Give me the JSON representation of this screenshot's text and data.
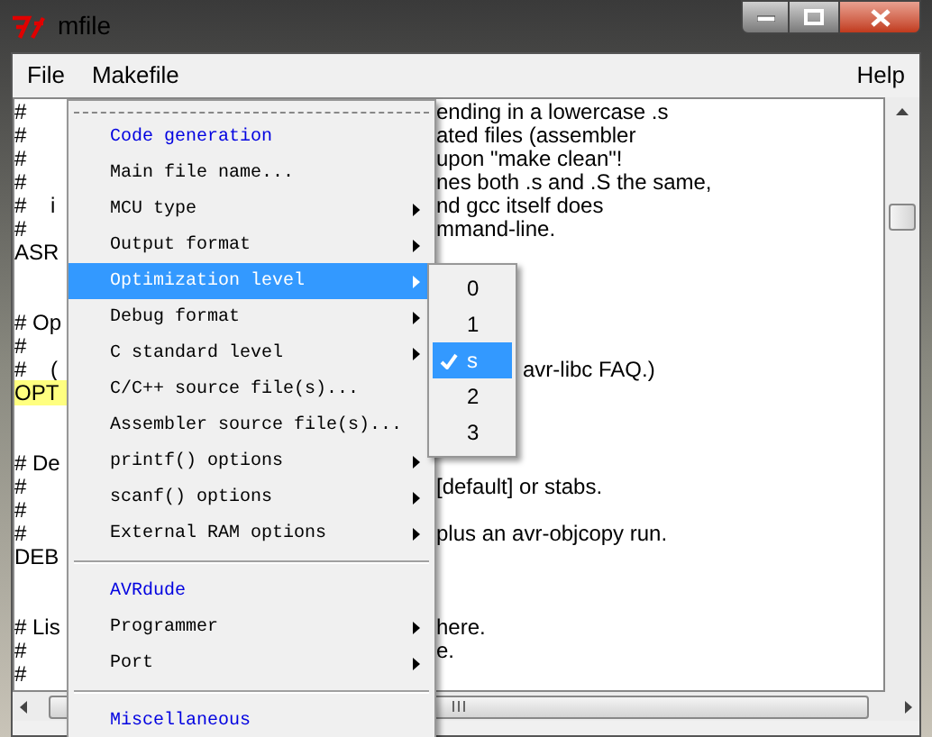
{
  "window": {
    "title": "mfile"
  },
  "menubar": [
    {
      "label": "File"
    },
    {
      "label": "Makefile"
    },
    {
      "label": "Help"
    }
  ],
  "editor_blocks": [
    {
      "lines": [
        {
          "left": "#",
          "right": "ending in a lowercase .s"
        },
        {
          "left": "#",
          "right": "ated files (assembler"
        },
        {
          "left": "#",
          "right": "upon \"make clean\"!"
        },
        {
          "left": "#",
          "right": "nes both .s and .S the same,"
        },
        {
          "left": "#    i",
          "right": "nd gcc itself does"
        },
        {
          "left": "#",
          "right": "mmand-line."
        },
        {
          "left": "ASR"
        }
      ]
    },
    {
      "lines": [
        {
          "left": "# Op"
        },
        {
          "left": "#"
        },
        {
          "left": "#    (",
          "right": "avr-libc FAQ.)"
        },
        {
          "left": "OPT",
          "highlighted": true
        }
      ]
    },
    {
      "lines": [
        {
          "left": "# De"
        },
        {
          "left": "#",
          "right": "[default] or stabs."
        },
        {
          "left": "#"
        },
        {
          "left": "#",
          "right": "plus an avr-objcopy run."
        },
        {
          "left": "DEB"
        }
      ]
    },
    {
      "lines": [
        {
          "left": "# Lis",
          "right": "here."
        },
        {
          "left": "#",
          "right": "e."
        },
        {
          "left": "#"
        }
      ]
    }
  ],
  "menu": {
    "items": [
      {
        "kind": "header",
        "label": "Code generation"
      },
      {
        "kind": "item",
        "label": "Main file name...",
        "submenu": false,
        "selected": false
      },
      {
        "kind": "item",
        "label": "MCU type",
        "submenu": true,
        "selected": false
      },
      {
        "kind": "item",
        "label": "Output format",
        "submenu": true,
        "selected": false
      },
      {
        "kind": "item",
        "label": "Optimization level",
        "submenu": true,
        "selected": true
      },
      {
        "kind": "item",
        "label": "Debug format",
        "submenu": true,
        "selected": false
      },
      {
        "kind": "item",
        "label": "C standard level",
        "submenu": true,
        "selected": false
      },
      {
        "kind": "item",
        "label": "C/C++ source file(s)...",
        "submenu": false,
        "selected": false
      },
      {
        "kind": "item",
        "label": "Assembler source file(s)...",
        "submenu": false,
        "selected": false
      },
      {
        "kind": "item",
        "label": "printf() options",
        "submenu": true,
        "selected": false
      },
      {
        "kind": "item",
        "label": "scanf() options",
        "submenu": true,
        "selected": false
      },
      {
        "kind": "item",
        "label": "External RAM options",
        "submenu": true,
        "selected": false
      },
      {
        "kind": "separator"
      },
      {
        "kind": "header",
        "label": "AVRdude"
      },
      {
        "kind": "item",
        "label": "Programmer",
        "submenu": true,
        "selected": false
      },
      {
        "kind": "item",
        "label": "Port",
        "submenu": true,
        "selected": false
      },
      {
        "kind": "separator"
      },
      {
        "kind": "header",
        "label": "Miscellaneous"
      }
    ]
  },
  "submenu": {
    "items": [
      {
        "label": "0",
        "checked": false,
        "selected": false
      },
      {
        "label": "1",
        "checked": false,
        "selected": false
      },
      {
        "label": "s",
        "checked": true,
        "selected": true
      },
      {
        "label": "2",
        "checked": false,
        "selected": false
      },
      {
        "label": "3",
        "checked": false,
        "selected": false
      }
    ]
  }
}
